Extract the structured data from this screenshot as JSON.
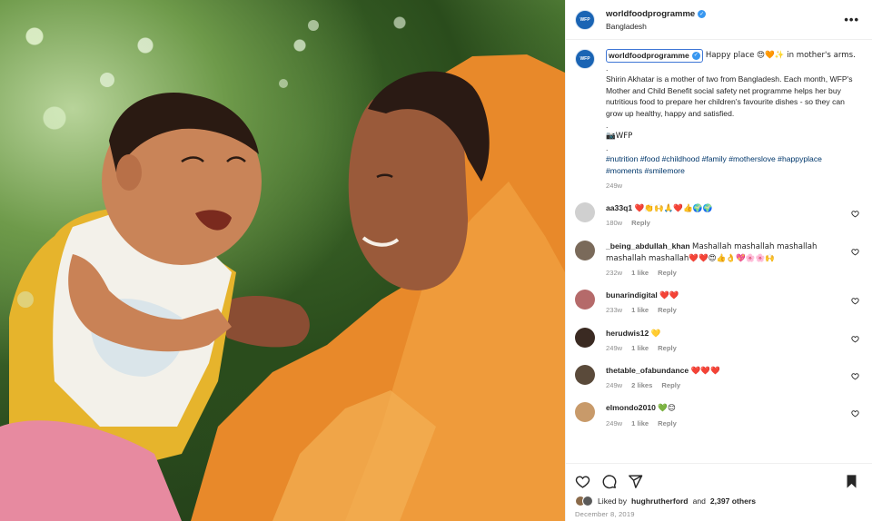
{
  "post": {
    "username": "worldfoodprogramme",
    "location": "Bangladesh",
    "more_label": "•••",
    "photo_alt": ""
  },
  "caption": {
    "username": "worldfoodprogramme",
    "first_line": "Happy place 😍🧡✨ in mother's arms.",
    "dot1": ".",
    "body": "Shirin Akhatar is a mother of two from Bangladesh. Each month, WFP's Mother and Child Benefit social safety net programme helps her buy nutritious food to prepare her children's favourite dishes - so they can grow up healthy, happy and satisfied.",
    "dot2": ".",
    "signature": "📷WFP",
    "dot3": ".",
    "hashtags": "#nutrition #food #childhood #family #motherslove #happyplace #moments #smilemore",
    "time": "249w"
  },
  "comments": [
    {
      "username": "aa33q1",
      "text": "❤️👏🙌🙏❤️👍🌍🌍",
      "time": "180w",
      "likes": "",
      "reply": "Reply",
      "avatar_color": "#d0d0d0"
    },
    {
      "username": "_being_abdullah_khan",
      "text": "Mashallah mashallah mashallah mashallah mashallah❤️❤️😍👍👌💖🌸🌸🙌",
      "time": "232w",
      "likes": "1 like",
      "reply": "Reply",
      "avatar_color": "#7a6a5a"
    },
    {
      "username": "bunarindigital",
      "text": "❤️❤️",
      "time": "233w",
      "likes": "1 like",
      "reply": "Reply",
      "avatar_color": "#b56a6a"
    },
    {
      "username": "herudwis12",
      "text": "💛",
      "time": "249w",
      "likes": "1 like",
      "reply": "Reply",
      "avatar_color": "#3a2a22"
    },
    {
      "username": "thetable_ofabundance",
      "text": "❤️❤️❤️",
      "time": "249w",
      "likes": "2 likes",
      "reply": "Reply",
      "avatar_color": "#5a4a3a"
    },
    {
      "username": "elmondo2010",
      "text": "💚😊",
      "time": "249w",
      "likes": "1 like",
      "reply": "Reply",
      "avatar_color": "#c89a6a"
    }
  ],
  "footer": {
    "liked_by_prefix": "Liked by",
    "liked_by_user": "hughrutherford",
    "liked_by_and": "and",
    "liked_by_count": "2,397 others",
    "date": "December 8, 2019"
  },
  "icons": {
    "like": "heart-icon",
    "comment": "comment-icon",
    "share": "share-icon",
    "save": "bookmark-icon",
    "verified": "verified-badge-icon"
  },
  "colors": {
    "link": "#00376b",
    "verified": "#3897f0",
    "muted": "#8e8e8e",
    "highlight_border": "#3f77d6",
    "wfp_blue": "#1a64b4"
  }
}
